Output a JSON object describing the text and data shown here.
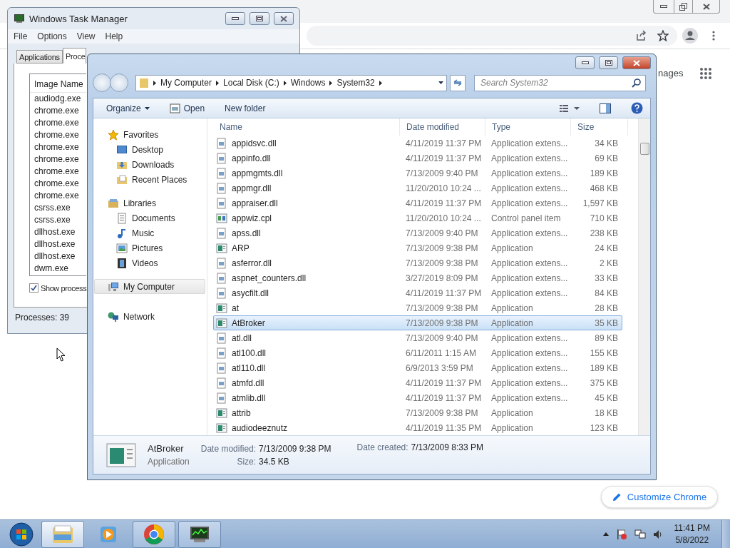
{
  "chrome": {
    "partial_link": "nages",
    "customize_button": "Customize Chrome"
  },
  "task_manager": {
    "title": "Windows Task Manager",
    "menu": [
      "File",
      "Options",
      "View",
      "Help"
    ],
    "tabs": [
      {
        "label": "Applications",
        "selected": false
      },
      {
        "label": "Proce",
        "selected": true
      }
    ],
    "column": "Image Name",
    "processes": [
      "audiodg.exe",
      "chrome.exe",
      "chrome.exe",
      "chrome.exe",
      "chrome.exe",
      "chrome.exe",
      "chrome.exe",
      "chrome.exe",
      "chrome.exe",
      "csrss.exe",
      "csrss.exe",
      "dllhost.exe",
      "dllhost.exe",
      "dllhost.exe",
      "dwm.exe"
    ],
    "show_all": {
      "label": "Show process",
      "checked": true
    },
    "status": "Processes: 39"
  },
  "explorer": {
    "breadcrumb": [
      "My Computer",
      "Local Disk (C:)",
      "Windows",
      "System32"
    ],
    "search": {
      "placeholder": "Search System32"
    },
    "toolbar": [
      {
        "label": "Organize",
        "kind": "menu"
      },
      {
        "label": "Open",
        "kind": "open"
      },
      {
        "label": "New folder",
        "kind": "plain"
      }
    ],
    "nav": [
      {
        "label": "Favorites",
        "kind": "star",
        "selected": false,
        "children": [
          {
            "label": "Desktop",
            "kind": "desktop",
            "selected": false
          },
          {
            "label": "Downloads",
            "kind": "download",
            "selected": false
          },
          {
            "label": "Recent Places",
            "kind": "recent",
            "selected": false
          }
        ]
      },
      {
        "label": "Libraries",
        "kind": "library",
        "selected": false,
        "children": [
          {
            "label": "Documents",
            "kind": "documents",
            "selected": false
          },
          {
            "label": "Music",
            "kind": "music",
            "selected": false
          },
          {
            "label": "Pictures",
            "kind": "pictures",
            "selected": false
          },
          {
            "label": "Videos",
            "kind": "videos",
            "selected": false
          }
        ]
      },
      {
        "label": "My Computer",
        "kind": "computer",
        "selected": true
      },
      {
        "label": "Network",
        "kind": "network",
        "selected": false
      }
    ],
    "columns": [
      "Name",
      "Date modified",
      "Type",
      "Size"
    ],
    "files": [
      {
        "name": "appidsvc.dll",
        "date": "4/11/2019 11:37 PM",
        "type": "Application extens...",
        "size": "34 KB",
        "kind": "dll",
        "selected": false
      },
      {
        "name": "appinfo.dll",
        "date": "4/11/2019 11:37 PM",
        "type": "Application extens...",
        "size": "69 KB",
        "kind": "dll",
        "selected": false
      },
      {
        "name": "appmgmts.dll",
        "date": "7/13/2009 9:40 PM",
        "type": "Application extens...",
        "size": "189 KB",
        "kind": "dll",
        "selected": false
      },
      {
        "name": "appmgr.dll",
        "date": "11/20/2010 10:24 ...",
        "type": "Application extens...",
        "size": "468 KB",
        "kind": "dll",
        "selected": false
      },
      {
        "name": "appraiser.dll",
        "date": "4/11/2019 11:37 PM",
        "type": "Application extens...",
        "size": "1,597 KB",
        "kind": "dll",
        "selected": false
      },
      {
        "name": "appwiz.cpl",
        "date": "11/20/2010 10:24 ...",
        "type": "Control panel item",
        "size": "710 KB",
        "kind": "cpl",
        "selected": false
      },
      {
        "name": "apss.dll",
        "date": "7/13/2009 9:40 PM",
        "type": "Application extens...",
        "size": "238 KB",
        "kind": "dll",
        "selected": false
      },
      {
        "name": "ARP",
        "date": "7/13/2009 9:38 PM",
        "type": "Application",
        "size": "24 KB",
        "kind": "exe",
        "selected": false
      },
      {
        "name": "asferror.dll",
        "date": "7/13/2009 9:38 PM",
        "type": "Application extens...",
        "size": "2 KB",
        "kind": "dll",
        "selected": false
      },
      {
        "name": "aspnet_counters.dll",
        "date": "3/27/2019 8:09 PM",
        "type": "Application extens...",
        "size": "33 KB",
        "kind": "dll",
        "selected": false
      },
      {
        "name": "asycfilt.dll",
        "date": "4/11/2019 11:37 PM",
        "type": "Application extens...",
        "size": "84 KB",
        "kind": "dll",
        "selected": false
      },
      {
        "name": "at",
        "date": "7/13/2009 9:38 PM",
        "type": "Application",
        "size": "28 KB",
        "kind": "exe",
        "selected": false
      },
      {
        "name": "AtBroker",
        "date": "7/13/2009 9:38 PM",
        "type": "Application",
        "size": "35 KB",
        "kind": "exe",
        "selected": true
      },
      {
        "name": "atl.dll",
        "date": "7/13/2009 9:40 PM",
        "type": "Application extens...",
        "size": "89 KB",
        "kind": "dll",
        "selected": false
      },
      {
        "name": "atl100.dll",
        "date": "6/11/2011 1:15 AM",
        "type": "Application extens...",
        "size": "155 KB",
        "kind": "dll",
        "selected": false
      },
      {
        "name": "atl110.dll",
        "date": "6/9/2013 3:59 PM",
        "type": "Application extens...",
        "size": "189 KB",
        "kind": "dll",
        "selected": false
      },
      {
        "name": "atmfd.dll",
        "date": "4/11/2019 11:37 PM",
        "type": "Application extens...",
        "size": "375 KB",
        "kind": "dll",
        "selected": false
      },
      {
        "name": "atmlib.dll",
        "date": "4/11/2019 11:37 PM",
        "type": "Application extens...",
        "size": "45 KB",
        "kind": "dll",
        "selected": false
      },
      {
        "name": "attrib",
        "date": "7/13/2009 9:38 PM",
        "type": "Application",
        "size": "18 KB",
        "kind": "exe",
        "selected": false
      },
      {
        "name": "audiodeeznutz",
        "date": "4/11/2019 11:35 PM",
        "type": "Application",
        "size": "123 KB",
        "kind": "exe",
        "selected": false
      }
    ],
    "details": {
      "name": "AtBroker",
      "type": "Application",
      "modified_label": "Date modified:",
      "modified": "7/13/2009 9:38 PM",
      "size_label": "Size:",
      "size": "34.5 KB",
      "created_label": "Date created:",
      "created": "7/13/2009 8:33 PM"
    }
  },
  "taskbar": {
    "items": [
      {
        "kind": "explorer",
        "running": true,
        "selected": true
      },
      {
        "kind": "media",
        "running": false,
        "selected": false
      },
      {
        "kind": "chrome",
        "running": true,
        "selected": false
      },
      {
        "kind": "taskmgr",
        "running": true,
        "selected": false
      }
    ],
    "clock": {
      "time": "11:41 PM",
      "date": "5/8/2022"
    }
  }
}
